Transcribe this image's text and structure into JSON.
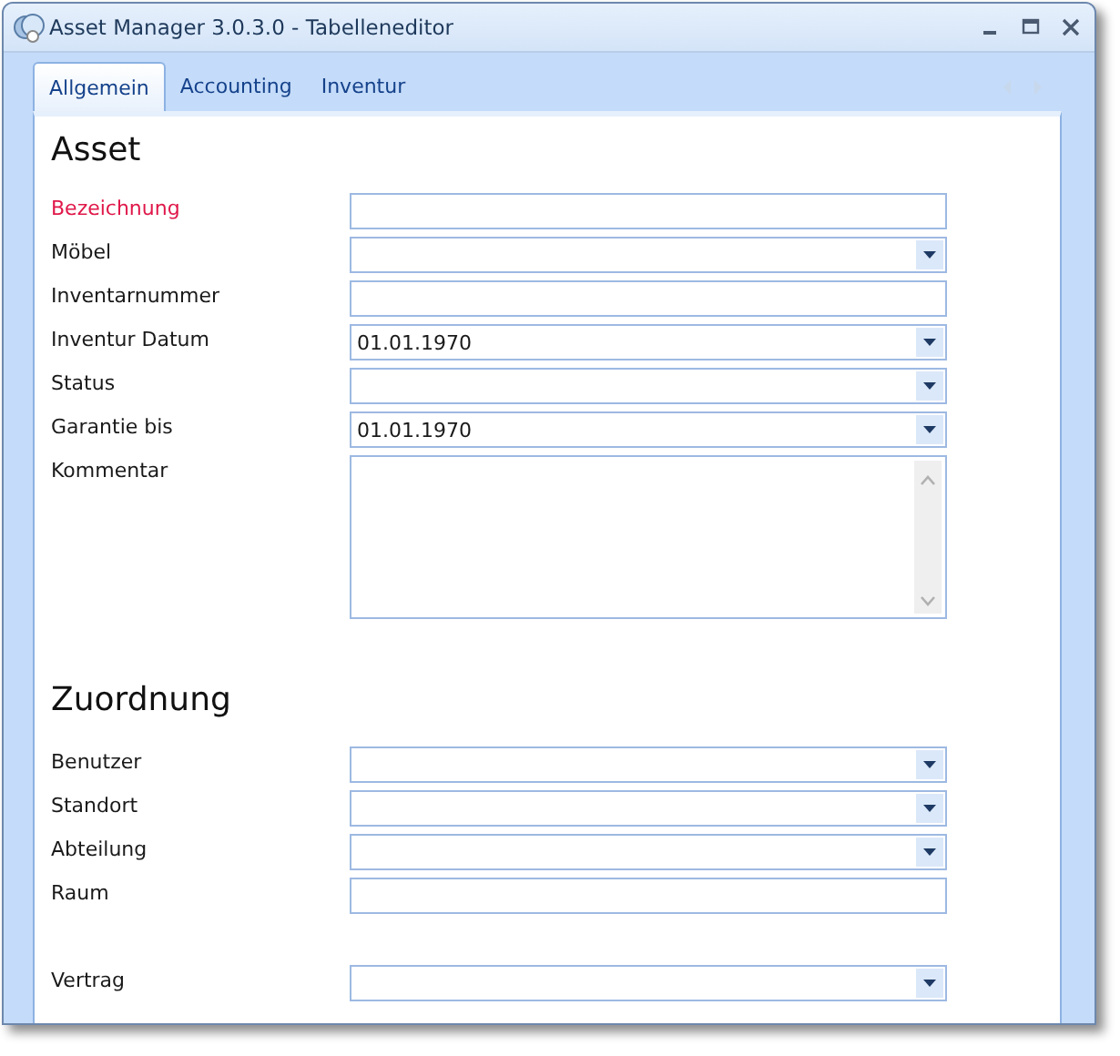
{
  "window": {
    "title": "Asset Manager 3.0.3.0 - Tabelleneditor"
  },
  "tabs": [
    {
      "label": "Allgemein",
      "selected": true
    },
    {
      "label": "Accounting",
      "selected": false
    },
    {
      "label": "Inventur",
      "selected": false
    }
  ],
  "sections": [
    {
      "heading": "Asset",
      "fields": [
        {
          "label": "Bezeichnung",
          "kind": "text",
          "required": true
        },
        {
          "label": "Möbel",
          "kind": "combo",
          "required": false
        },
        {
          "label": "Inventarnummer",
          "kind": "text",
          "required": false
        },
        {
          "label": "Inventur Datum",
          "kind": "combo",
          "required": false,
          "value": "01.01.1970"
        },
        {
          "label": "Status",
          "kind": "combo",
          "required": false
        },
        {
          "label": "Garantie bis",
          "kind": "combo",
          "required": false,
          "value": "01.01.1970"
        },
        {
          "label": "Kommentar",
          "kind": "memo",
          "required": false
        }
      ]
    },
    {
      "heading": "Zuordnung",
      "fields": [
        {
          "label": "Benutzer",
          "kind": "combo",
          "required": false
        },
        {
          "label": "Standort",
          "kind": "combo",
          "required": false
        },
        {
          "label": "Abteilung",
          "kind": "combo",
          "required": false
        },
        {
          "label": "Raum",
          "kind": "text",
          "required": false
        },
        {
          "kind": "blank"
        },
        {
          "label": "Vertrag",
          "kind": "combo",
          "required": false
        }
      ]
    }
  ]
}
